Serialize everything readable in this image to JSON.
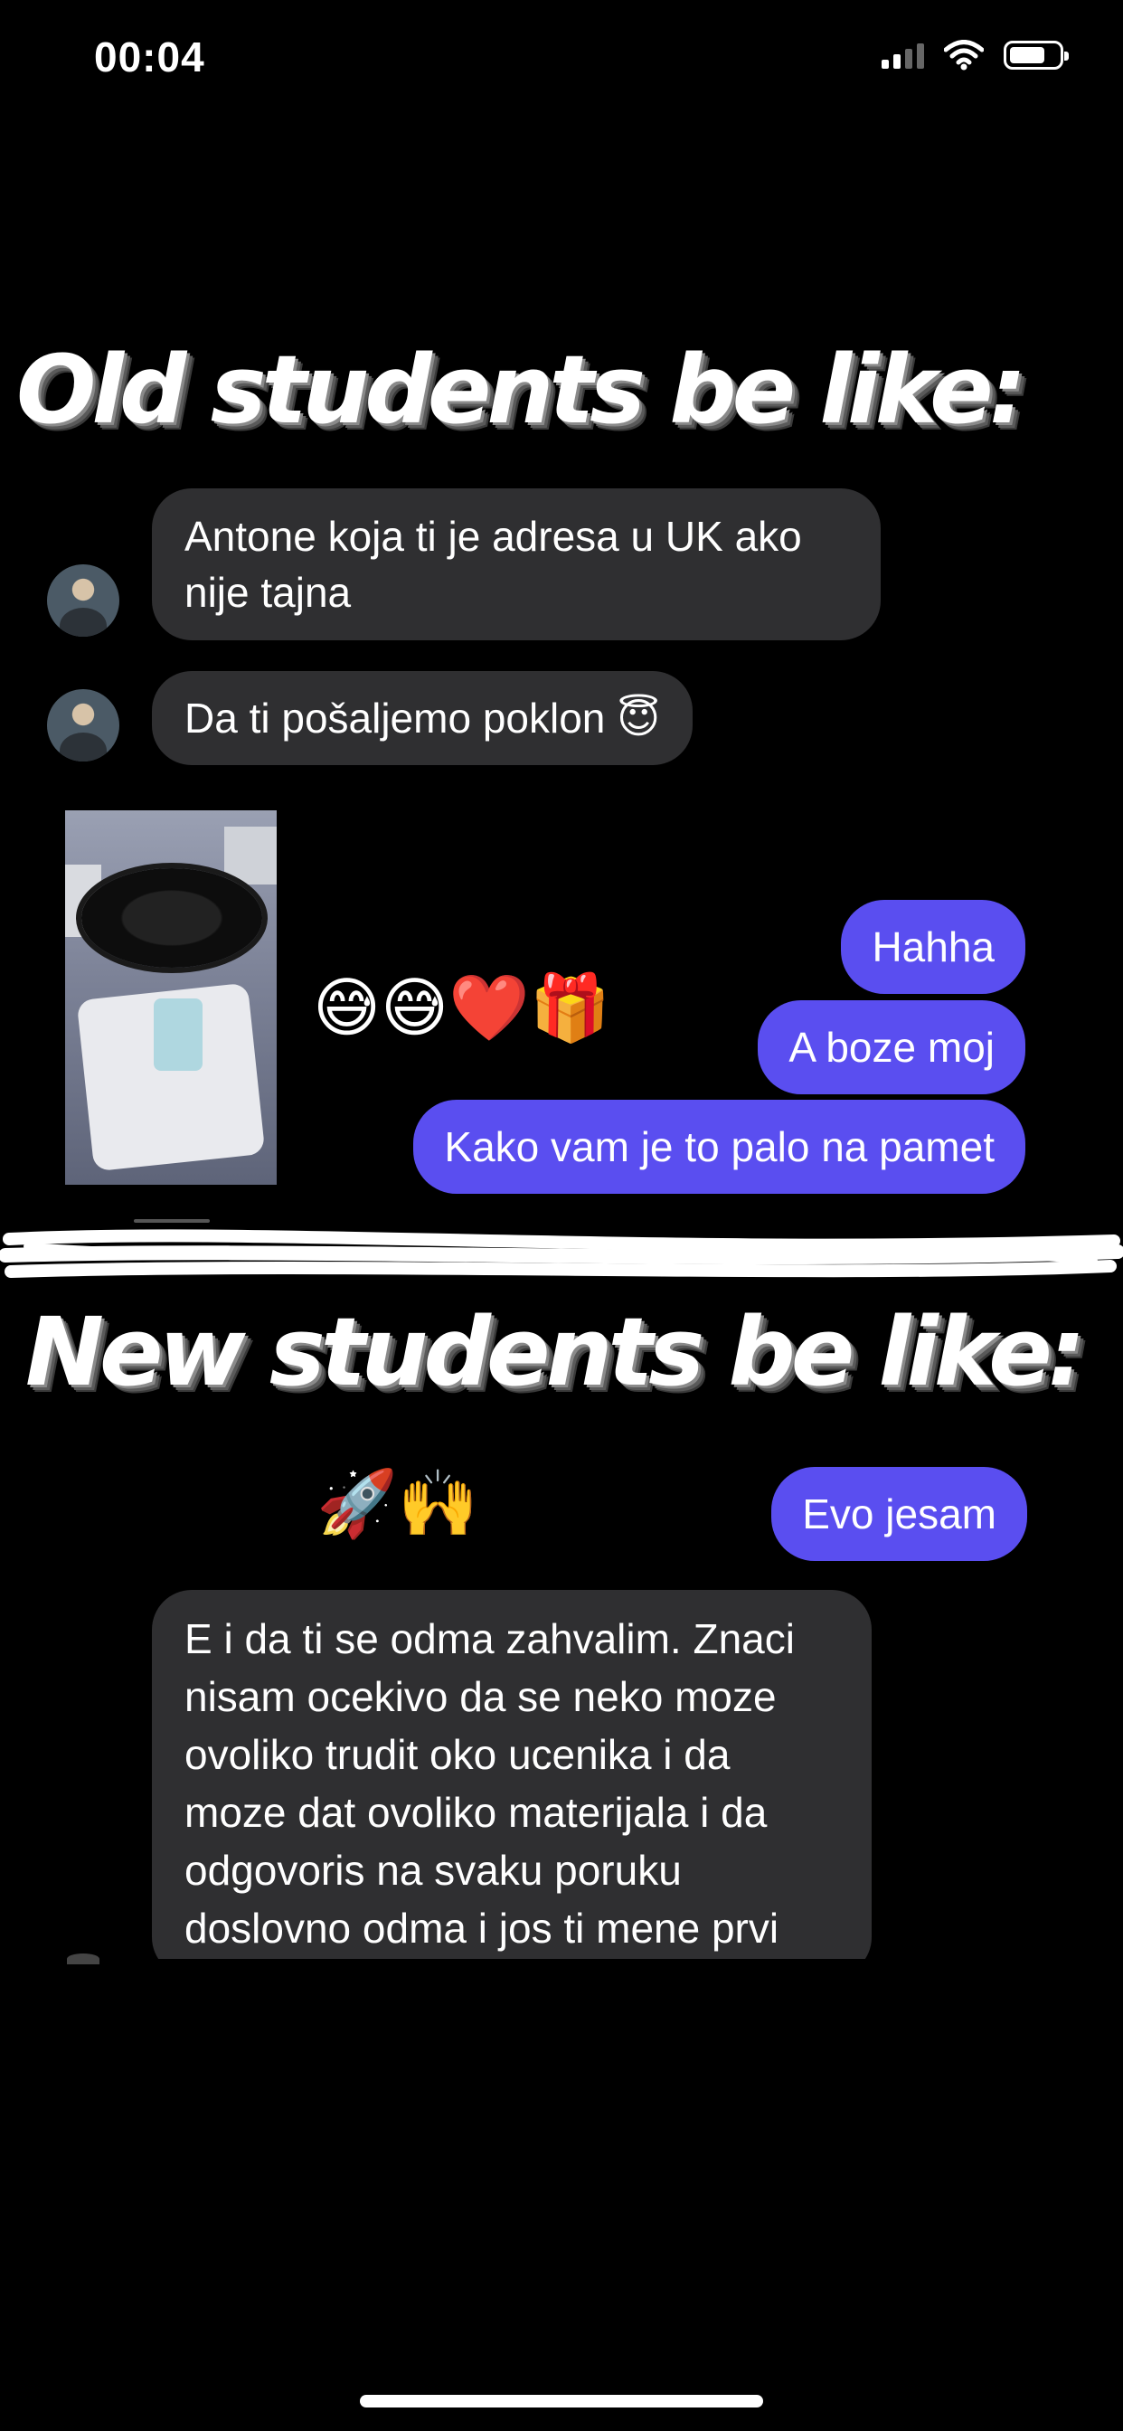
{
  "status_bar": {
    "time": "00:04"
  },
  "headings": {
    "old": "Old students be like:",
    "new": "New students be like:"
  },
  "old_chat": {
    "incoming": [
      "Antone koja ti je adresa u UK ako nije tajna",
      "Da ti pošaljemo poklon 😇"
    ],
    "reactions": "😅😅❤️🎁",
    "outgoing": [
      "Hahha",
      "A boze moj",
      "Kako vam je to palo na pamet"
    ]
  },
  "new_chat": {
    "reactions": "🚀🙌",
    "outgoing": [
      "Evo jesam"
    ],
    "incoming": [
      "E i da ti se odma zahvalim. Znaci nisam ocekivo da se neko moze ovoliko trudit oko ucenika i da moze dat ovoliko materijala i da odgovoris na svaku poruku doslovno odma i jos ti mene prvi"
    ]
  },
  "colors": {
    "background": "#000000",
    "incoming_bubble": "#2f2f31",
    "outgoing_bubble": "#5a4ef0"
  },
  "icons": [
    "signal-icon",
    "wifi-icon",
    "battery-icon"
  ]
}
